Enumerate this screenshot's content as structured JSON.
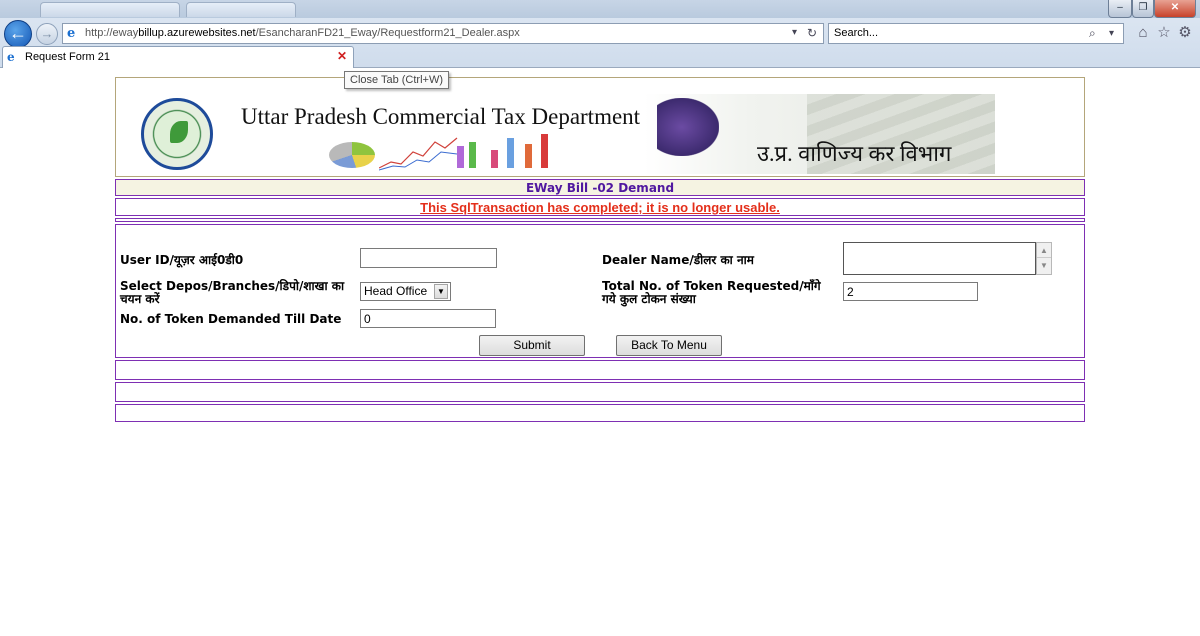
{
  "browser": {
    "url_prefix": "http://eway",
    "url_domain": "billup.azurewebsites.net",
    "url_path": "/EsancharanFD21_Eway/Requestform21_Dealer.aspx",
    "search_placeholder": "Search...",
    "tab_label": "Request Form 21",
    "tooltip": "Close Tab (Ctrl+W)"
  },
  "banner": {
    "title_en": "Uttar Pradesh Commercial Tax Department",
    "title_hi": "उ.प्र. वाणिज्य कर विभाग"
  },
  "page": {
    "form_title": "EWay Bill -02 Demand",
    "error_message": "This SqlTransaction has completed; it is no longer usable."
  },
  "form": {
    "user_id_label": "User ID/यूज़र आई0डी0",
    "user_id_value": "",
    "dealer_name_label": "Dealer Name/डीलर का नाम",
    "dealer_name_value": "",
    "depot_label": "Select Depos/Branches/डिपो/शाखा का चयन करें",
    "depot_value": "Head Office",
    "total_tokens_label": "Total No. of Token Requested/माँगे गये कुल टोकन संख्या",
    "total_tokens_value": "2",
    "tokens_till_date_label": "No. of Token Demanded Till Date",
    "tokens_till_date_value": "0",
    "submit_label": "Submit",
    "back_label": "Back To Menu"
  }
}
